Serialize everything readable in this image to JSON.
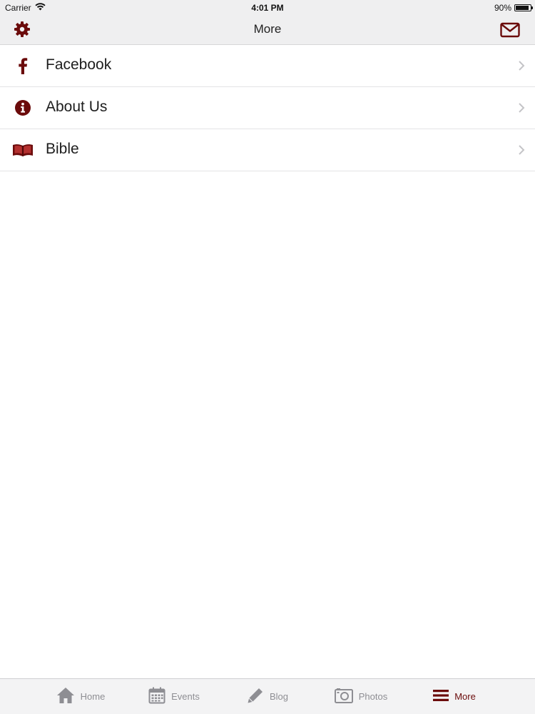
{
  "status_bar": {
    "carrier": "Carrier",
    "time": "4:01 PM",
    "battery_text": "90%",
    "battery_level": 0.9
  },
  "nav": {
    "title": "More",
    "left_icon": "gear-icon",
    "right_icon": "mail-icon"
  },
  "list": {
    "items": [
      {
        "label": "Facebook",
        "icon": "facebook-icon"
      },
      {
        "label": "About Us",
        "icon": "info-icon"
      },
      {
        "label": "Bible",
        "icon": "book-icon"
      }
    ]
  },
  "tabs": [
    {
      "label": "Home",
      "icon": "home-icon",
      "active": false
    },
    {
      "label": "Events",
      "icon": "calendar-icon",
      "active": false
    },
    {
      "label": "Blog",
      "icon": "pencil-icon",
      "active": false
    },
    {
      "label": "Photos",
      "icon": "camera-icon",
      "active": false
    },
    {
      "label": "More",
      "icon": "menu-icon",
      "active": true
    }
  ],
  "colors": {
    "accent": "#6b0b0b",
    "inactive": "#8e8e93",
    "bar_bg": "#efeff0"
  }
}
